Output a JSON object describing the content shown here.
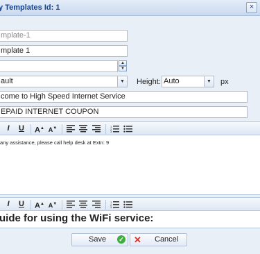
{
  "window": {
    "title": "y Templates Id: 1",
    "close_glyph": "×"
  },
  "form": {
    "field1_placeholder": "mplate-1",
    "field2_value": "mplate 1",
    "field3_value": "",
    "combo_value": "ault",
    "height_label": "Height:",
    "height_value": "Auto",
    "px_label": "px",
    "field_welcome": "come to High Speed Internet Service",
    "field_coupon": "EPAID INTERNET COUPON"
  },
  "toolbar": {
    "italic": "I",
    "underline": "U",
    "grow_font": "A",
    "shrink_font": "A"
  },
  "editor1": {
    "text": "any assistance, please call help desk at Extn: 9"
  },
  "editor2": {
    "text": "uide for using the WiFi service:"
  },
  "buttons": {
    "save": "Save",
    "cancel": "Cancel"
  },
  "colors": {
    "title_text": "#15428b",
    "save_icon": "#3fae3f",
    "cancel_icon": "#d9322b"
  }
}
